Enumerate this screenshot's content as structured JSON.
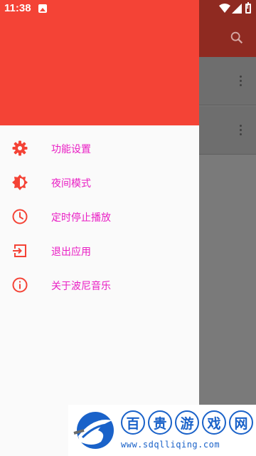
{
  "status_bar": {
    "time": "11:38",
    "icons": [
      "image-icon",
      "wifi-icon",
      "cell-signal-icon",
      "battery-alert-icon"
    ]
  },
  "background_app": {
    "toolbar_color": "#8f2a21",
    "toolbar_icons": [
      "search-icon"
    ],
    "row_icons": [
      "more-vert-icon",
      "more-vert-icon"
    ]
  },
  "drawer": {
    "header_color": "#f44336",
    "label_color": "#e91ec4",
    "icon_color": "#f44336",
    "items": [
      {
        "label": "功能设置",
        "icon": "gear-icon"
      },
      {
        "label": "夜间模式",
        "icon": "brightness-icon"
      },
      {
        "label": "定时停止播放",
        "icon": "clock-icon"
      },
      {
        "label": "退出应用",
        "icon": "exit-icon"
      },
      {
        "label": "关于波尼音乐",
        "icon": "info-icon"
      }
    ]
  },
  "watermark": {
    "chars": [
      "百",
      "贵",
      "游",
      "戏",
      "网"
    ],
    "url": "www.sdqlliqing.com",
    "color": "#1a62c9"
  }
}
